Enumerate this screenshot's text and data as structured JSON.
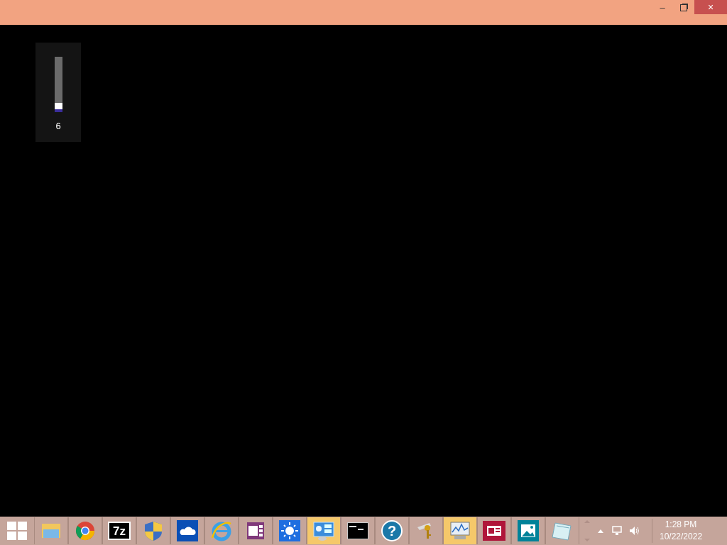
{
  "window": {
    "controls": [
      "–",
      "×"
    ]
  },
  "volume": {
    "level": 0.06,
    "reading": "6"
  },
  "taskbar": {
    "items": [
      {
        "kind": "folder",
        "selected": false
      },
      {
        "kind": "chrome",
        "selected": false
      },
      {
        "kind": "archive",
        "label": "7z",
        "selected": false
      },
      {
        "kind": "shield",
        "selected": false
      },
      {
        "kind": "cloud",
        "selected": false
      },
      {
        "kind": "browser",
        "selected": false
      },
      {
        "kind": "notebook",
        "selected": false
      },
      {
        "kind": "sun",
        "selected": false
      },
      {
        "kind": "panel",
        "selected": true
      },
      {
        "kind": "terminal",
        "selected": false
      },
      {
        "kind": "help",
        "label": "?",
        "selected": false
      },
      {
        "kind": "keys",
        "selected": false
      },
      {
        "kind": "monitor",
        "selected": true
      },
      {
        "kind": "news",
        "selected": false
      },
      {
        "kind": "photo",
        "selected": false
      },
      {
        "kind": "notepad",
        "selected": false
      }
    ],
    "clock": {
      "time": "1:28 PM",
      "date": "10/22/2022"
    }
  }
}
